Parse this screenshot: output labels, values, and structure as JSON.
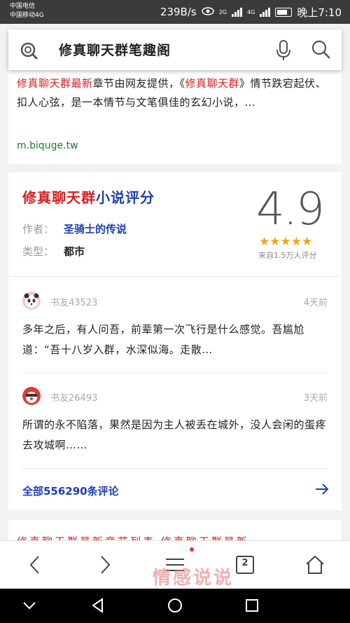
{
  "status_bar": {
    "carrier1": "中国电信",
    "carrier2": "中国移动4G",
    "speed": "239B/s",
    "net1": "2G",
    "net2": "4G",
    "time": "晚上7:10"
  },
  "search": {
    "query": "修真聊天群笔趣阁",
    "logo_icon": "search-engine-logo-icon",
    "mic_icon": "microphone-icon",
    "search_icon": "magnifier-icon"
  },
  "result1": {
    "snippet_red1": "修真聊天群最新",
    "snippet_mid": "章节由网友提供，《",
    "snippet_red2": "修真聊天群",
    "snippet_rest": "》情节跌宕起伏、扣人心弦，是一本情节与文笔俱佳的玄幻小说，...",
    "url": "m.biquge.tw"
  },
  "review": {
    "title_red": "修真聊天群",
    "title_blue": "小说评分",
    "author_label": "作者：",
    "author": "圣骑士的传说",
    "type_label": "类型：",
    "type": "都市",
    "score": "4.9",
    "stars": "★★★★★",
    "rating_count": "来自1.5万人评分",
    "comments": [
      {
        "user": "书友43523",
        "time": "4天前",
        "text": "多年之后，有人问吾，前辈第一次飞行是什么感觉。吾尴尬道：“吾十八岁入群，水深似海。走散…"
      },
      {
        "user": "书友26493",
        "time": "3天前",
        "text": "所谓的永不陷落，果然是因为主人被丢在城外，没人会闲的蛋疼去攻城啊……"
      }
    ],
    "all_comments": "全部556290条评论"
  },
  "result3": {
    "partial_text": "修真聊天群最新章节列表 修真聊天群最新"
  },
  "bottom_nav": {
    "tab_count": "2",
    "watermark": "情感说说"
  },
  "colors": {
    "accent_red": "#d81e1e",
    "accent_blue": "#1f3fae",
    "url_green": "#1b7a33",
    "star": "#f2a51a"
  }
}
